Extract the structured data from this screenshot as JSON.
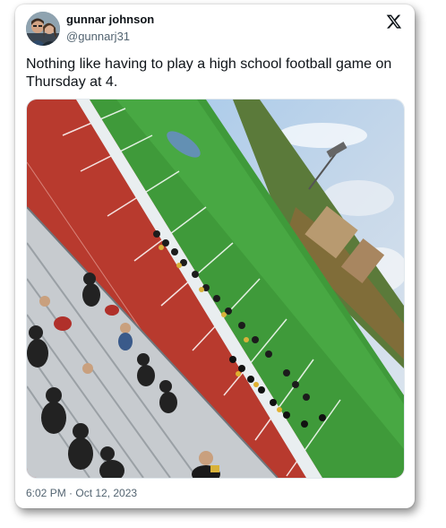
{
  "author": {
    "display_name": "gunnar johnson",
    "handle": "@gunnarj31"
  },
  "tweet": {
    "text": "Nothing like having to play a high school football game on Thursday at 4.",
    "timestamp": "6:02 PM · Oct 12, 2023"
  },
  "icons": {
    "brand": "x-logo-icon",
    "avatar": "profile-photo"
  },
  "colors": {
    "text_primary": "#0f1419",
    "text_secondary": "#536471",
    "track_red": "#b83a2e",
    "field_green": "#3f9a3a"
  }
}
